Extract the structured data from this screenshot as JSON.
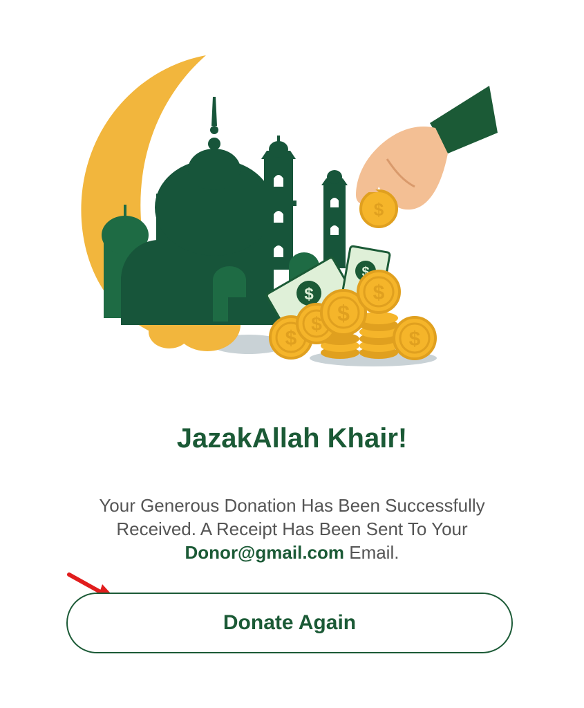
{
  "illustration": {
    "name": "mosque-crescent-donation-illustration",
    "colors": {
      "crescent": "#f2b63d",
      "mosque_dark": "#17553a",
      "mosque_mid": "#1e6b44",
      "coin": "#f5b52a",
      "bill": "#dff0d8",
      "sleeve": "#1b5a36",
      "skin": "#f3bf94",
      "shadow": "#c9d2d6"
    }
  },
  "content": {
    "title": "JazakAllah Khair!",
    "message_line1": "Your Generous Donation Has Been Successfully",
    "message_line2": "Received. A Receipt Has Been Sent To Your",
    "email": "Donor@gmail.com",
    "email_suffix": " Email."
  },
  "actions": {
    "donate_again_label": "Donate Again"
  },
  "annotation": {
    "arrow_color": "#e11d1d",
    "arrow_icon": "red-arrow-icon"
  }
}
